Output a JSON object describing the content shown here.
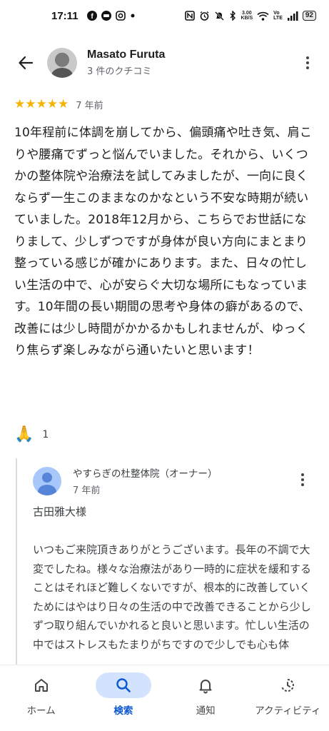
{
  "status_bar": {
    "time": "17:11",
    "net_speed_value": "3.00",
    "net_speed_unit": "KB/S",
    "battery": "92",
    "icons": [
      "facebook-icon",
      "line-icon",
      "instagram-icon",
      "dot-icon",
      "nfc-icon",
      "alarm-icon",
      "mute-icon",
      "bluetooth-icon",
      "wifi-icon",
      "volte-icon",
      "signal-icon"
    ]
  },
  "header": {
    "user_name": "Masato Furuta",
    "review_count": "3 件のクチコミ"
  },
  "review": {
    "rating": 5,
    "stars": "★★★★★",
    "time": "7 年前",
    "text": "10年程前に体調を崩してから、偏頭痛や吐き気、肩こりや腰痛でずっと悩んでいました。それから、いくつかの整体院や治療法を試してみましたが、一向に良くならず一生このままなのかなという不安な時期が続いていました。2018年12月から、こちらでお世話になりまして、少しずつですが身体が良い方向にまとまり整っている感じが確かにあります。また、日々の忙しい生活の中で、心が安らぐ大切な場所にもなっています。10年間の長い期間の思考や身体の癖があるので、改善には少し時間がかかるかもしれませんが、ゆっくり焦らず楽しみながら通いたいと思います！"
  },
  "reaction": {
    "emoji": "🙏",
    "count": "1"
  },
  "owner_response": {
    "name": "やすらぎの杜整体院（オーナー）",
    "time": "7 年前",
    "text": "古田雅大様\n\nいつもご来院頂きありがとうございます。長年の不調で大変でしたね。様々な治療法があり一時的に症状を緩和することはそれほど難しくないですが、根本的に改善していくためにはやはり日々の生活の中で改善できることから少しずつ取り組んでいかれると良いと思います。忙しい生活の中ではストレスもたまりがちですので少しでも心も体"
  },
  "bottom_nav": {
    "items": [
      {
        "label": "ホーム",
        "icon": "home-icon",
        "active": false
      },
      {
        "label": "検索",
        "icon": "search-icon",
        "active": true
      },
      {
        "label": "通知",
        "icon": "bell-icon",
        "active": false
      },
      {
        "label": "アクティビティ",
        "icon": "activity-icon",
        "active": false
      }
    ]
  },
  "colors": {
    "star": "#f5b400",
    "active_nav_bg": "#d3e3fd",
    "active_nav_text": "#0b57d0",
    "owner_avatar_bg": "#a8c7fa"
  }
}
